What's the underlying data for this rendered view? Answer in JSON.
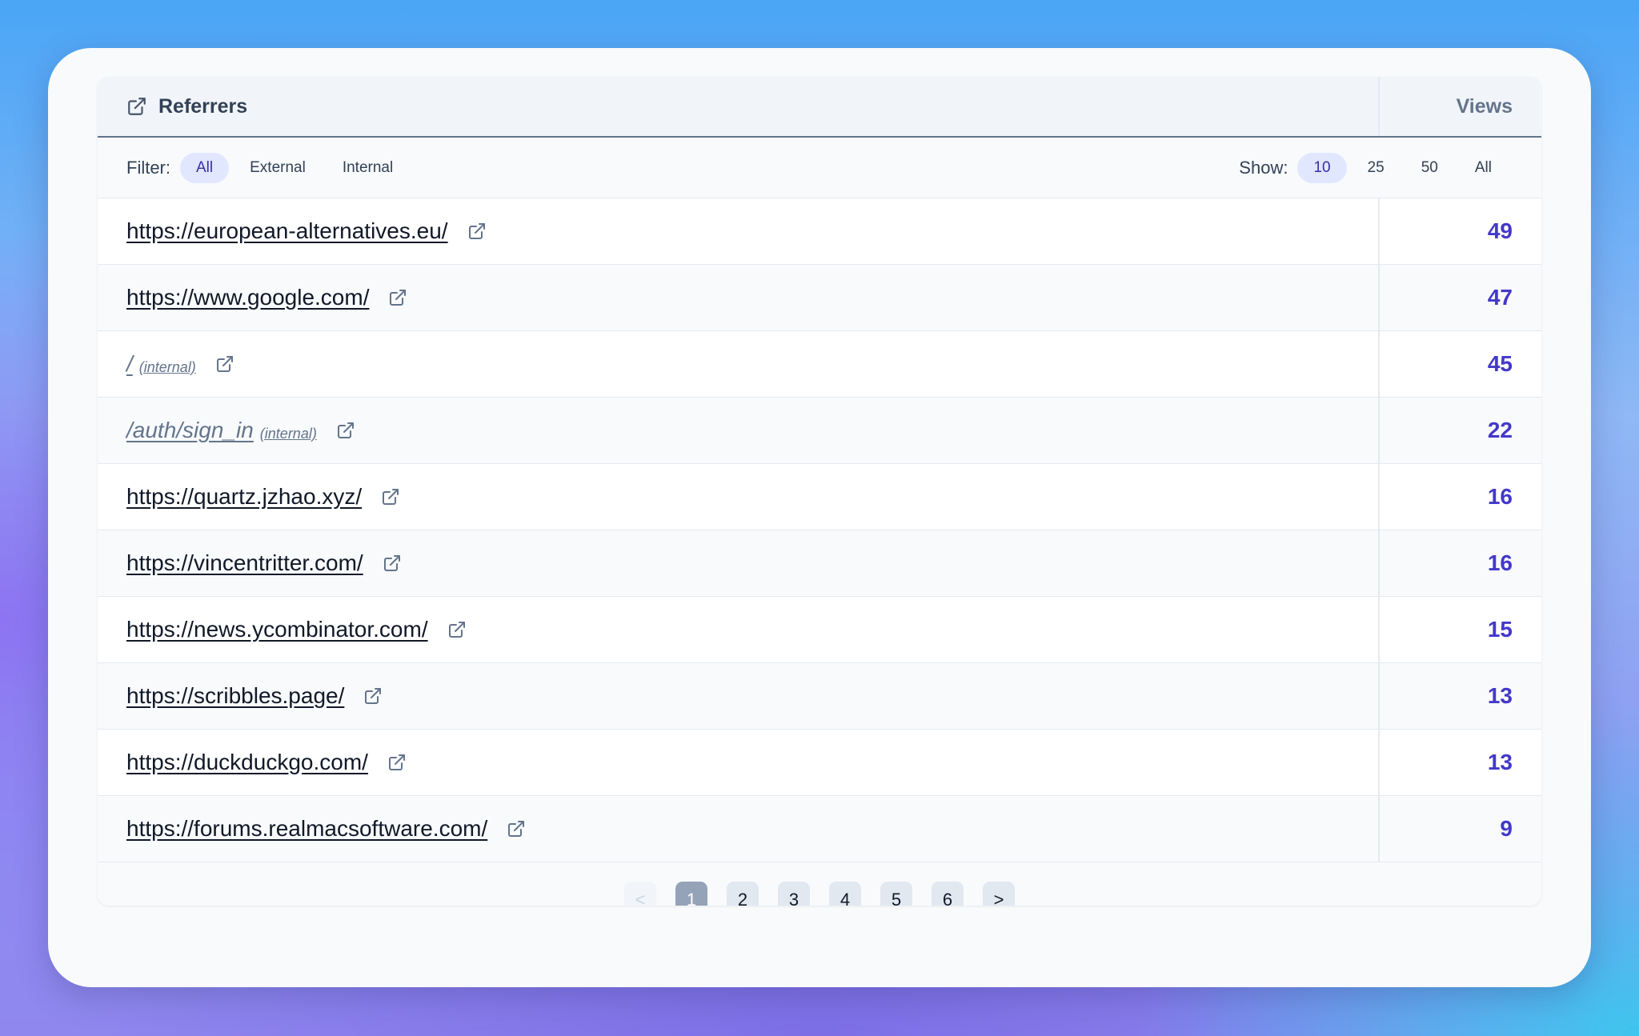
{
  "header": {
    "title": "Referrers",
    "views_label": "Views"
  },
  "filter": {
    "label": "Filter:",
    "options": [
      "All",
      "External",
      "Internal"
    ],
    "active": "All"
  },
  "show": {
    "label": "Show:",
    "options": [
      "10",
      "25",
      "50",
      "All"
    ],
    "active": "10"
  },
  "rows": [
    {
      "url": "https://european-alternatives.eu/",
      "internal": false,
      "tag": "",
      "views": "49"
    },
    {
      "url": "https://www.google.com/",
      "internal": false,
      "tag": "",
      "views": "47"
    },
    {
      "url": "/",
      "internal": true,
      "tag": "(internal)",
      "views": "45"
    },
    {
      "url": "/auth/sign_in",
      "internal": true,
      "tag": "(internal)",
      "views": "22"
    },
    {
      "url": "https://quartz.jzhao.xyz/",
      "internal": false,
      "tag": "",
      "views": "16"
    },
    {
      "url": "https://vincentritter.com/",
      "internal": false,
      "tag": "",
      "views": "16"
    },
    {
      "url": "https://news.ycombinator.com/",
      "internal": false,
      "tag": "",
      "views": "15"
    },
    {
      "url": "https://scribbles.page/",
      "internal": false,
      "tag": "",
      "views": "13"
    },
    {
      "url": "https://duckduckgo.com/",
      "internal": false,
      "tag": "",
      "views": "13"
    },
    {
      "url": "https://forums.realmacsoftware.com/",
      "internal": false,
      "tag": "",
      "views": "9"
    }
  ],
  "pagination": {
    "prev": "<",
    "next": ">",
    "pages": [
      "1",
      "2",
      "3",
      "4",
      "5",
      "6"
    ],
    "current": "1"
  },
  "colors": {
    "accent": "#4338ca",
    "active_pill_bg": "#e0e7ff",
    "current_page_bg": "#94a3b8"
  },
  "icons": {
    "header": "external-link-icon",
    "row": "external-link-icon"
  }
}
